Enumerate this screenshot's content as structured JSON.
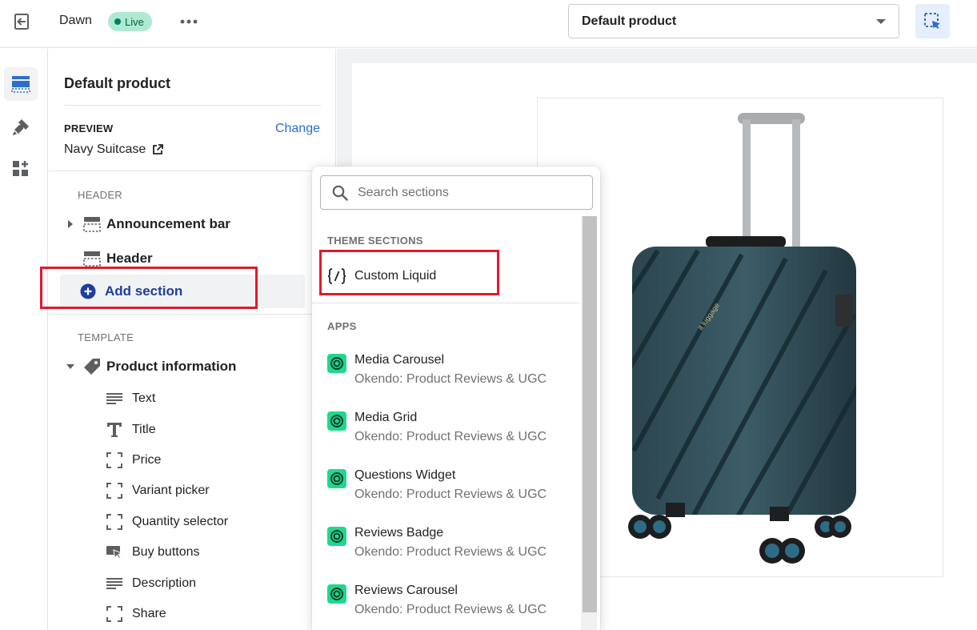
{
  "topbar": {
    "theme_name": "Dawn",
    "live_badge": "Live",
    "template_select": "Default product"
  },
  "sidebar": {
    "title": "Default product",
    "preview_label": "PREVIEW",
    "change_link": "Change",
    "preview_value": "Navy Suitcase",
    "header_group_label": "HEADER",
    "header_items": [
      {
        "label": "Announcement bar",
        "icon": "layout-section-icon"
      },
      {
        "label": "Header",
        "icon": "layout-header-icon"
      }
    ],
    "add_section_label": "Add section",
    "template_group_label": "TEMPLATE",
    "template_section": {
      "label": "Product information",
      "icon": "tag-icon"
    },
    "blocks": [
      {
        "label": "Text",
        "icon": "text-lines-icon"
      },
      {
        "label": "Title",
        "icon": "title-icon"
      },
      {
        "label": "Price",
        "icon": "block-frame-icon"
      },
      {
        "label": "Variant picker",
        "icon": "block-frame-icon"
      },
      {
        "label": "Quantity selector",
        "icon": "block-frame-icon"
      },
      {
        "label": "Buy buttons",
        "icon": "buy-button-icon"
      },
      {
        "label": "Description",
        "icon": "text-lines-icon"
      },
      {
        "label": "Share",
        "icon": "block-frame-icon"
      }
    ]
  },
  "popover": {
    "search_placeholder": "Search sections",
    "theme_sections_label": "THEME SECTIONS",
    "custom_liquid_label": "Custom Liquid",
    "apps_label": "APPS",
    "apps": [
      {
        "name": "Media Carousel",
        "vendor": "Okendo: Product Reviews & UGC"
      },
      {
        "name": "Media Grid",
        "vendor": "Okendo: Product Reviews & UGC"
      },
      {
        "name": "Questions Widget",
        "vendor": "Okendo: Product Reviews & UGC"
      },
      {
        "name": "Reviews Badge",
        "vendor": "Okendo: Product Reviews & UGC"
      },
      {
        "name": "Reviews Carousel",
        "vendor": "Okendo: Product Reviews & UGC"
      }
    ]
  },
  "colors": {
    "accent_blue": "#2c6ecb",
    "add_section_blue": "#1f3e9c",
    "highlight_red": "#e3192b",
    "live_green": "#aee9d1",
    "okendo_green": "#1fd88f"
  }
}
